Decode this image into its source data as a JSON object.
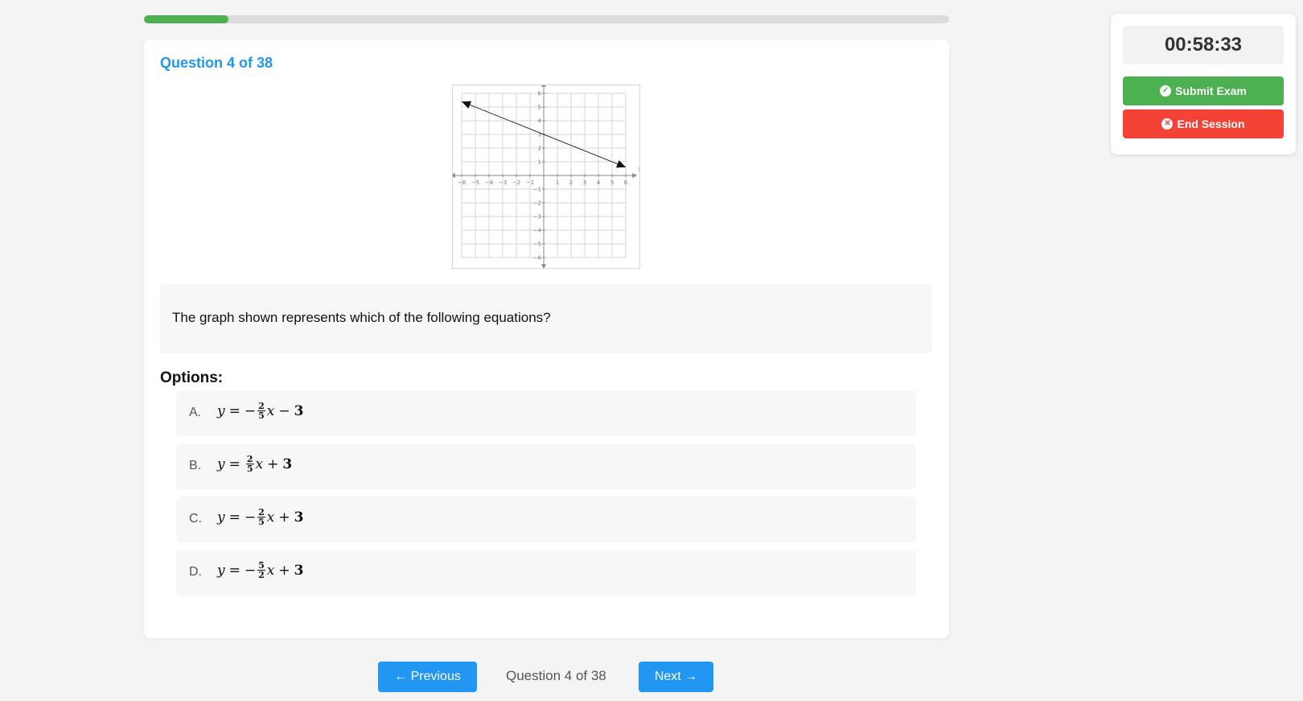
{
  "progress": {
    "current": 4,
    "total": 38,
    "fraction": 0.105
  },
  "question": {
    "header": "Question 4 of 38",
    "text": "The graph shown represents which of the following equations?"
  },
  "graph": {
    "x_label": "x",
    "y_label": "y",
    "x_ticks": [
      "−6",
      "−5",
      "−4",
      "−3",
      "−2",
      "−1",
      "1",
      "2",
      "3",
      "4",
      "5",
      "6"
    ],
    "y_ticks": [
      "6",
      "5",
      "4",
      "3",
      "2",
      "1",
      "−1",
      "−2",
      "−3",
      "−4",
      "−5",
      "−6"
    ],
    "line_points": [
      [
        -6,
        5.4
      ],
      [
        6,
        0.6
      ]
    ]
  },
  "options_title": "Options:",
  "options": [
    {
      "letter": "A.",
      "lhs": "y",
      "sign": "−",
      "num": "2",
      "den": "5",
      "var": "x",
      "op": "−",
      "const": "3"
    },
    {
      "letter": "B.",
      "lhs": "y",
      "sign": "",
      "num": "2",
      "den": "5",
      "var": "x",
      "op": "+",
      "const": "3"
    },
    {
      "letter": "C.",
      "lhs": "y",
      "sign": "−",
      "num": "2",
      "den": "5",
      "var": "x",
      "op": "+",
      "const": "3"
    },
    {
      "letter": "D.",
      "lhs": "y",
      "sign": "−",
      "num": "5",
      "den": "2",
      "var": "x",
      "op": "+",
      "const": "3"
    }
  ],
  "nav": {
    "previous_label": "← Previous",
    "counter": "Question 4 of 38",
    "next_label": "Next →"
  },
  "side_panel": {
    "timer": "00:58:33",
    "submit_label": "Submit Exam",
    "end_label": "End Session",
    "submit_icon": "check-circle-icon",
    "end_icon": "x-circle-icon"
  },
  "colors": {
    "accent": "#2196f3",
    "success": "#4caf50",
    "danger": "#f44336"
  }
}
